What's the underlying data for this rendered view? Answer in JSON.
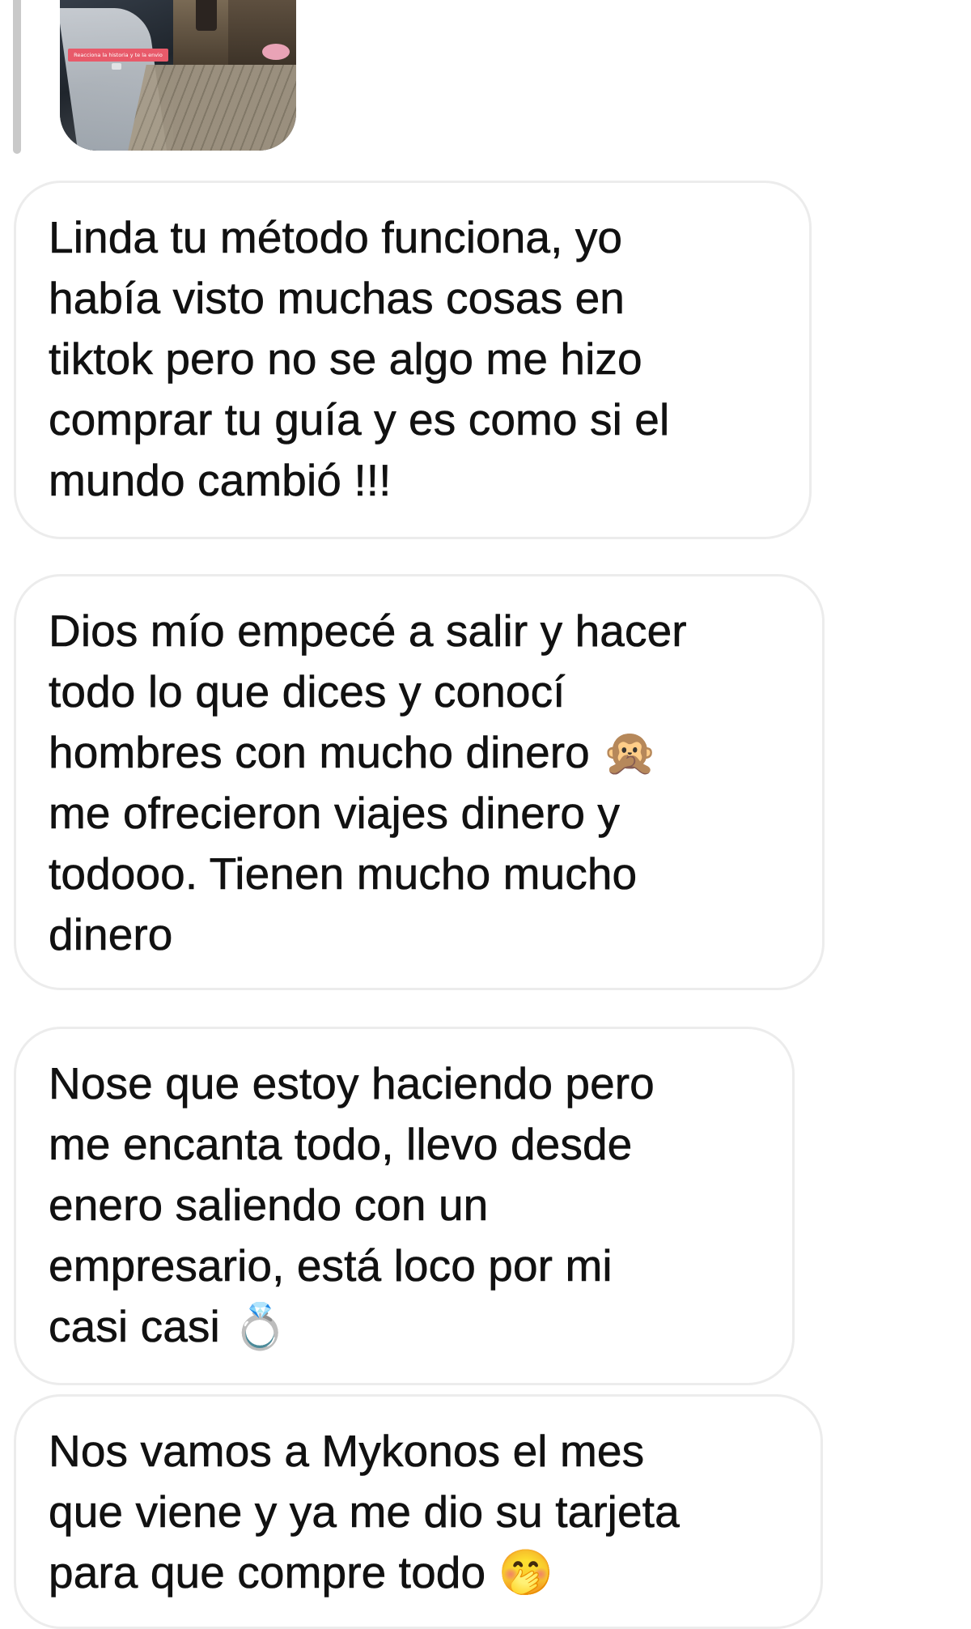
{
  "story_reply": {
    "caption": "Reacciona la historia y te la envio"
  },
  "messages": [
    {
      "text": "Linda tu método funciona, yo\nhabía visto muchas cosas en\ntiktok pero no se algo me hizo\ncomprar tu guía y es como si el\nmundo cambió !!!"
    },
    {
      "text": "Dios mío empecé a salir y hacer\ntodo lo que dices y conocí\nhombres con mucho dinero 🙊\nme ofrecieron viajes dinero y\ntodooo. Tienen mucho mucho\ndinero"
    },
    {
      "text": "Nose que estoy haciendo pero\nme encanta todo, llevo desde\nenero saliendo con un\nempresario, está loco por mi\ncasi casi 💍"
    },
    {
      "text": "Nos vamos a Mykonos el mes\nque viene y ya me dio su tarjeta\npara que compre todo 🤭"
    }
  ]
}
